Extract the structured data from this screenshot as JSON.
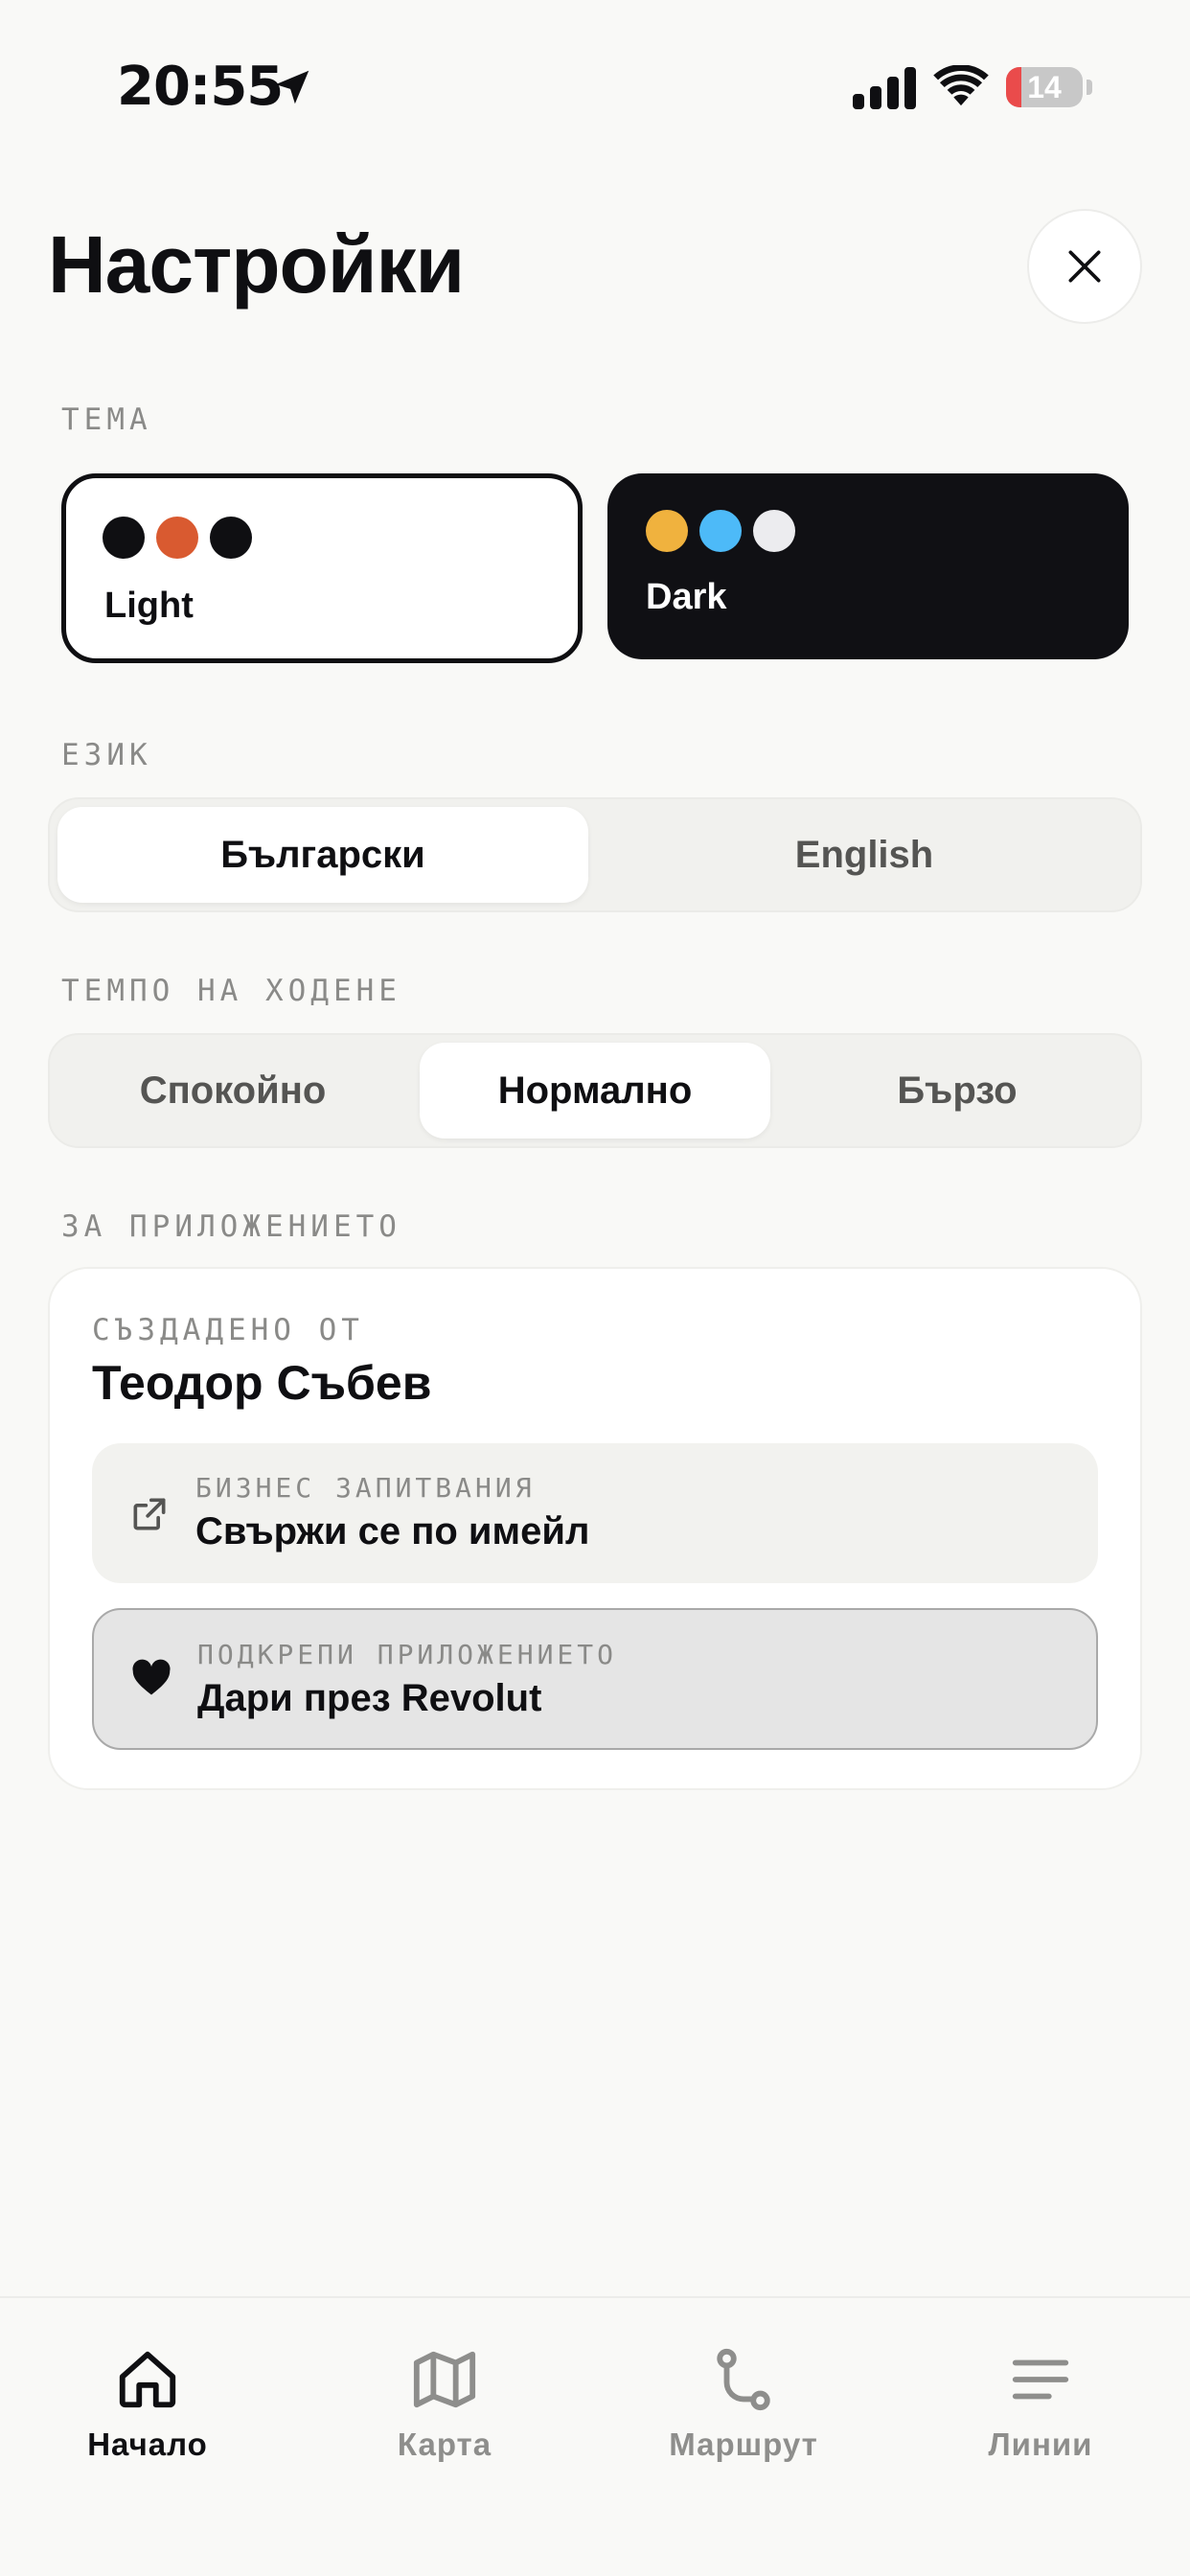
{
  "status": {
    "time": "20:55",
    "battery": "14"
  },
  "page": {
    "title": "Настройки"
  },
  "theme": {
    "label": "ТЕМА",
    "options": [
      {
        "name": "Light",
        "colors": [
          "#0f0f12",
          "#d95a30",
          "#0f0f12"
        ],
        "selected": true
      },
      {
        "name": "Dark",
        "colors": [
          "#f0b23e",
          "#4dbaf8",
          "#ececef"
        ],
        "selected": false
      }
    ]
  },
  "language": {
    "label": "ЕЗИК",
    "options": [
      "Български",
      "English"
    ],
    "selected": "Български"
  },
  "pace": {
    "label": "ТЕМПО НА ХОДЕНЕ",
    "options": [
      "Спокойно",
      "Нормално",
      "Бързо"
    ],
    "selected": "Нормално"
  },
  "about": {
    "label": "ЗА ПРИЛОЖЕНИЕТО",
    "created_label": "СЪЗДАДЕНО ОТ",
    "author": "Теодор Събев",
    "contact": {
      "kicker": "БИЗНЕС ЗАПИТВАНИЯ",
      "title": "Свържи се по имейл",
      "icon": "external-link-icon"
    },
    "donate": {
      "kicker": "ПОДКРЕПИ ПРИЛОЖЕНИЕТО",
      "title": "Дари през Revolut",
      "icon": "heart-icon"
    }
  },
  "tabs": [
    {
      "label": "Начало",
      "icon": "home-icon",
      "active": true
    },
    {
      "label": "Карта",
      "icon": "map-icon",
      "active": false
    },
    {
      "label": "Маршрут",
      "icon": "route-icon",
      "active": false
    },
    {
      "label": "Линии",
      "icon": "menu-icon",
      "active": false
    }
  ],
  "colors": {
    "background": "#f9f9f7",
    "text": "#0f0f12",
    "muted": "#8a8a88",
    "battery_low": "#ea4b4b"
  }
}
